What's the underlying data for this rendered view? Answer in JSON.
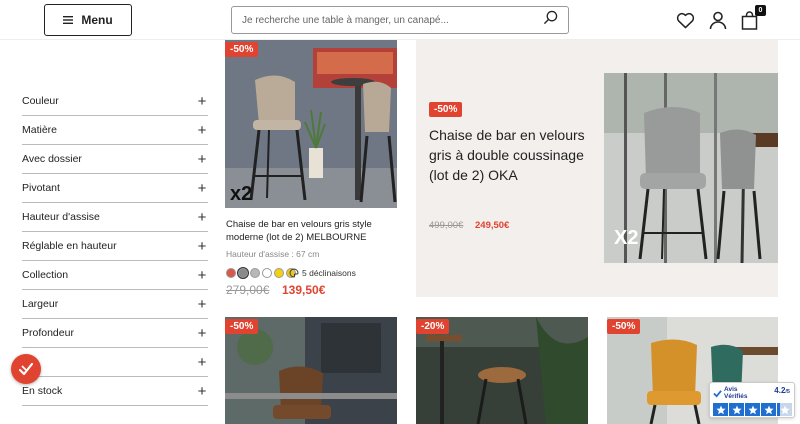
{
  "header": {
    "menu_label": "Menu",
    "search_placeholder": "Je recherche une table à manger, un canapé...",
    "cart_count": "0"
  },
  "filters": [
    {
      "label": "Couleur"
    },
    {
      "label": "Matière"
    },
    {
      "label": "Avec dossier"
    },
    {
      "label": "Pivotant"
    },
    {
      "label": "Hauteur d'assise"
    },
    {
      "label": "Réglable en hauteur"
    },
    {
      "label": "Collection"
    },
    {
      "label": "Largeur"
    },
    {
      "label": "Profondeur"
    },
    {
      "label": ""
    },
    {
      "label": "En stock"
    }
  ],
  "products": [
    {
      "badge": "-50%",
      "overlay": "x2",
      "title": "Chaise de bar en velours gris style moderne (lot de 2) MELBOURNE",
      "subtitle": "Hauteur d'assise : 67 cm",
      "swatches": [
        "#d9584a",
        "#8a8a8a",
        "#b8b8b8",
        "#ffffff",
        "#f4d10e",
        "#e8c62a"
      ],
      "variants_text": "5 déclinaisons",
      "old_price": "279,00€",
      "new_price": "139,50€"
    }
  ],
  "featured": {
    "badge": "-50%",
    "title": "Chaise de bar en velours gris à double coussinage (lot de 2) OKA",
    "old_price": "499,00€",
    "new_price": "249,50€",
    "overlay": "X2"
  },
  "bottom_badges": [
    "-50%",
    "-20%",
    "-50%"
  ],
  "reviews_widget": {
    "brand_line1": "Avis",
    "brand_line2": "Vérifiés",
    "score": "4.2",
    "score_max": "/5"
  },
  "colors": {
    "accent": "#e0432f",
    "featured_bg": "#f3efec",
    "avis_blue": "#1f6fd1"
  }
}
